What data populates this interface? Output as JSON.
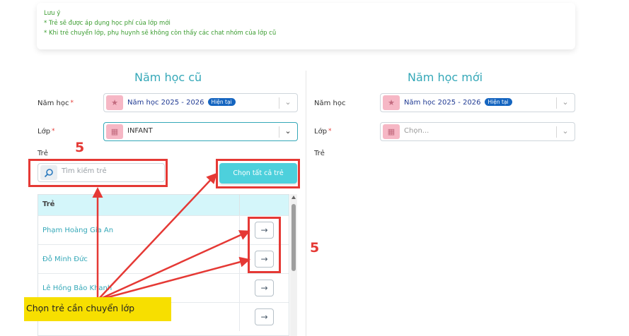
{
  "note": {
    "title": "Lưu ý",
    "line1": "* Trẻ sẽ được áp dụng học phí của lớp mới",
    "line2": "* Khi trẻ chuyển lớp, phụ huynh sẽ không còn thấy các chat nhóm của lớp cũ"
  },
  "old": {
    "title": "Năm học cũ",
    "year_label": "Năm học",
    "year_value": "Năm học 2025 - 2026",
    "year_badge": "Hiện tại",
    "class_label": "Lớp",
    "class_value": "INFANT",
    "child_label": "Trẻ",
    "search_placeholder": "Tìm kiếm trẻ",
    "select_all": "Chọn tất cả trẻ",
    "table_header": "Trẻ",
    "students": [
      "Phạm Hoàng Gia An",
      "Đỗ Minh Đức",
      "Lê Hồng Bảo Khanh",
      ""
    ]
  },
  "new": {
    "title": "Năm học mới",
    "year_label": "Năm học",
    "year_value": "Năm học 2025 - 2026",
    "year_badge": "Hiện tại",
    "class_label": "Lớp",
    "class_placeholder": "Chọn...",
    "child_label": "Trẻ"
  },
  "annotation": {
    "step_left": "5",
    "step_right": "5",
    "tip": "Chọn trẻ cần chuyển lớp"
  },
  "colors": {
    "accent": "#35a8b8",
    "highlight": "#e53935",
    "tip_bg": "#f7df00"
  }
}
